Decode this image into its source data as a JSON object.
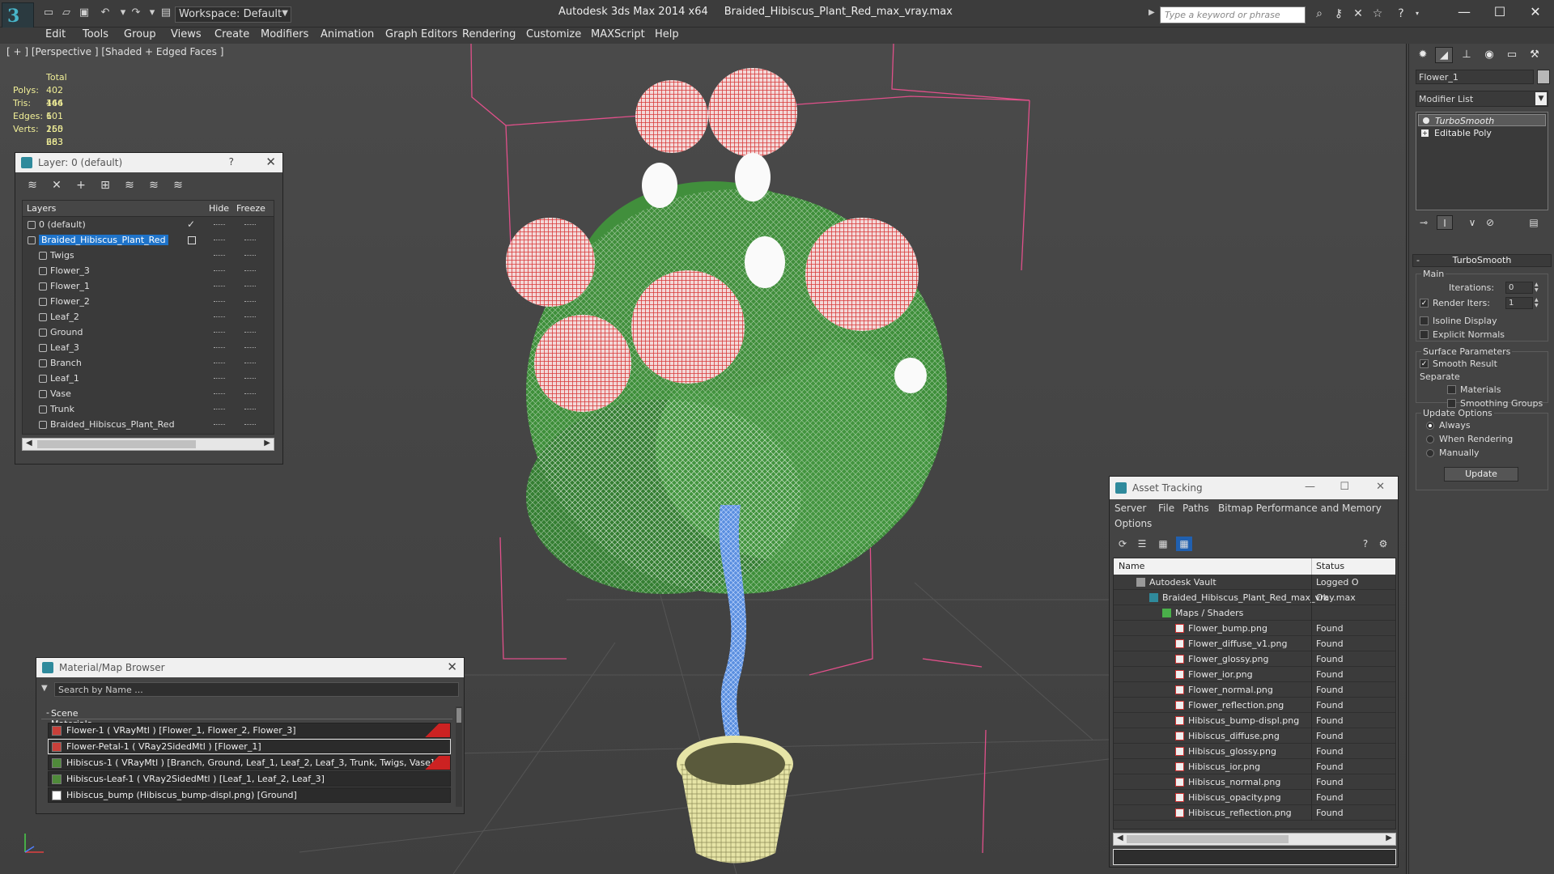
{
  "titlebar": {
    "app_name": "Autodesk 3ds Max  2014 x64",
    "file_name": "Braided_Hibiscus_Plant_Red_max_vray.max",
    "workspace_label": "Workspace: Default",
    "search_placeholder": "Type a keyword or phrase",
    "logo_text": "3"
  },
  "menu": [
    "Edit",
    "Tools",
    "Group",
    "Views",
    "Create",
    "Modifiers",
    "Animation",
    "Graph Editors",
    "Rendering",
    "Customize",
    "MAXScript",
    "Help"
  ],
  "viewport": {
    "label": "[ + ] [Perspective ] [Shaded + Edged Faces ]",
    "stats": {
      "header": "Total",
      "polys_label": "Polys:",
      "polys": "402 166",
      "tris_label": "Tris:",
      "tris": "444 601",
      "edges_label": "Edges:",
      "edges": "1 165 263",
      "verts_label": "Verts:",
      "verts": "250 683"
    }
  },
  "layer_window": {
    "title": "Layer: 0 (default)",
    "help": "?",
    "columns": {
      "layers": "Layers",
      "hide": "Hide",
      "freeze": "Freeze"
    },
    "rows": [
      {
        "name": "0 (default)",
        "indent": 0,
        "kind": "layer",
        "current": true
      },
      {
        "name": "Braided_Hibiscus_Plant_Red",
        "indent": 0,
        "kind": "layer",
        "selected": true
      },
      {
        "name": "Twigs",
        "indent": 1,
        "kind": "object"
      },
      {
        "name": "Flower_3",
        "indent": 1,
        "kind": "object"
      },
      {
        "name": "Flower_1",
        "indent": 1,
        "kind": "object"
      },
      {
        "name": "Flower_2",
        "indent": 1,
        "kind": "object"
      },
      {
        "name": "Leaf_2",
        "indent": 1,
        "kind": "object"
      },
      {
        "name": "Ground",
        "indent": 1,
        "kind": "object"
      },
      {
        "name": "Leaf_3",
        "indent": 1,
        "kind": "object"
      },
      {
        "name": "Branch",
        "indent": 1,
        "kind": "object"
      },
      {
        "name": "Leaf_1",
        "indent": 1,
        "kind": "object"
      },
      {
        "name": "Vase",
        "indent": 1,
        "kind": "object"
      },
      {
        "name": "Trunk",
        "indent": 1,
        "kind": "object"
      },
      {
        "name": "Braided_Hibiscus_Plant_Red",
        "indent": 1,
        "kind": "object"
      }
    ]
  },
  "material_browser": {
    "title": "Material/Map Browser",
    "search_placeholder": "Search by Name ...",
    "group_label": "Scene Materials",
    "items": [
      {
        "text": "Flower-1  ( VRayMtl )  [Flower_1, Flower_2, Flower_3]",
        "swatch": "#c8403a",
        "red_tag": true
      },
      {
        "text": "Flower-Petal-1  ( VRay2SidedMtl )  [Flower_1]",
        "swatch": "#c8403a",
        "red_tag": false,
        "highlight": true
      },
      {
        "text": "Hibiscus-1  ( VRayMtl )  [Branch, Ground, Leaf_1, Leaf_2, Leaf_3, Trunk, Twigs, Vase]",
        "swatch": "#4f8a3a",
        "red_tag": true
      },
      {
        "text": "Hibiscus-Leaf-1  ( VRay2SidedMtl )  [Leaf_1, Leaf_2, Leaf_3]",
        "swatch": "#4f8a3a",
        "red_tag": false
      },
      {
        "text": "Hibiscus_bump (Hibiscus_bump-displ.png) [Ground]",
        "swatch": "#ffffff",
        "red_tag": false
      }
    ]
  },
  "asset_tracking": {
    "title": "Asset Tracking",
    "menu": [
      "Server",
      "File",
      "Paths",
      "Bitmap Performance and Memory",
      "Options"
    ],
    "columns": {
      "name": "Name",
      "status": "Status"
    },
    "rows": [
      {
        "name": "Autodesk Vault",
        "status": "Logged O",
        "indent": 1,
        "icon": "vault"
      },
      {
        "name": "Braided_Hibiscus_Plant_Red_max_vray.max",
        "status": "Ok",
        "indent": 2,
        "icon": "max-file"
      },
      {
        "name": "Maps / Shaders",
        "status": "",
        "indent": 3,
        "icon": "maps"
      },
      {
        "name": "Flower_bump.png",
        "status": "Found",
        "indent": 4,
        "icon": "png"
      },
      {
        "name": "Flower_diffuse_v1.png",
        "status": "Found",
        "indent": 4,
        "icon": "png"
      },
      {
        "name": "Flower_glossy.png",
        "status": "Found",
        "indent": 4,
        "icon": "png"
      },
      {
        "name": "Flower_ior.png",
        "status": "Found",
        "indent": 4,
        "icon": "png"
      },
      {
        "name": "Flower_normal.png",
        "status": "Found",
        "indent": 4,
        "icon": "png"
      },
      {
        "name": "Flower_reflection.png",
        "status": "Found",
        "indent": 4,
        "icon": "png"
      },
      {
        "name": "Hibiscus_bump-displ.png",
        "status": "Found",
        "indent": 4,
        "icon": "png"
      },
      {
        "name": "Hibiscus_diffuse.png",
        "status": "Found",
        "indent": 4,
        "icon": "png"
      },
      {
        "name": "Hibiscus_glossy.png",
        "status": "Found",
        "indent": 4,
        "icon": "png"
      },
      {
        "name": "Hibiscus_ior.png",
        "status": "Found",
        "indent": 4,
        "icon": "png"
      },
      {
        "name": "Hibiscus_normal.png",
        "status": "Found",
        "indent": 4,
        "icon": "png"
      },
      {
        "name": "Hibiscus_opacity.png",
        "status": "Found",
        "indent": 4,
        "icon": "png"
      },
      {
        "name": "Hibiscus_reflection.png",
        "status": "Found",
        "indent": 4,
        "icon": "png"
      }
    ]
  },
  "command_panel": {
    "object_name": "Flower_1",
    "modifier_list": "Modifier List",
    "stack": [
      {
        "name": "TurboSmooth",
        "selected": true
      },
      {
        "name": "Editable Poly",
        "selected": false
      }
    ],
    "turbosmooth": {
      "title": "TurboSmooth",
      "main_label": "Main",
      "iterations_label": "Iterations:",
      "iterations": "0",
      "render_iters_label": "Render Iters:",
      "render_iters": "1",
      "render_iters_checked": true,
      "isoline_label": "Isoline Display",
      "isoline_checked": false,
      "explicit_normals_label": "Explicit Normals",
      "explicit_normals_checked": false,
      "surface_params_label": "Surface Parameters",
      "smooth_result_label": "Smooth Result",
      "smooth_result_checked": true,
      "separate_label": "Separate",
      "materials_label": "Materials",
      "materials_checked": false,
      "smoothing_groups_label": "Smoothing Groups",
      "smoothing_groups_checked": false,
      "update_options_label": "Update Options",
      "always_label": "Always",
      "when_rendering_label": "When Rendering",
      "manually_label": "Manually",
      "update_option": "Always",
      "update_button": "Update"
    }
  },
  "colors": {
    "selection_blue": "#1e73c9",
    "bounding_box_pink": "#e0508a",
    "stats_yellow": "#f2f098",
    "flower_red": "#d93a3a",
    "leaf_green": "#3e8f3a",
    "trunk_blue": "#5a8fe0",
    "vase_yellow": "#e6e4a6"
  }
}
